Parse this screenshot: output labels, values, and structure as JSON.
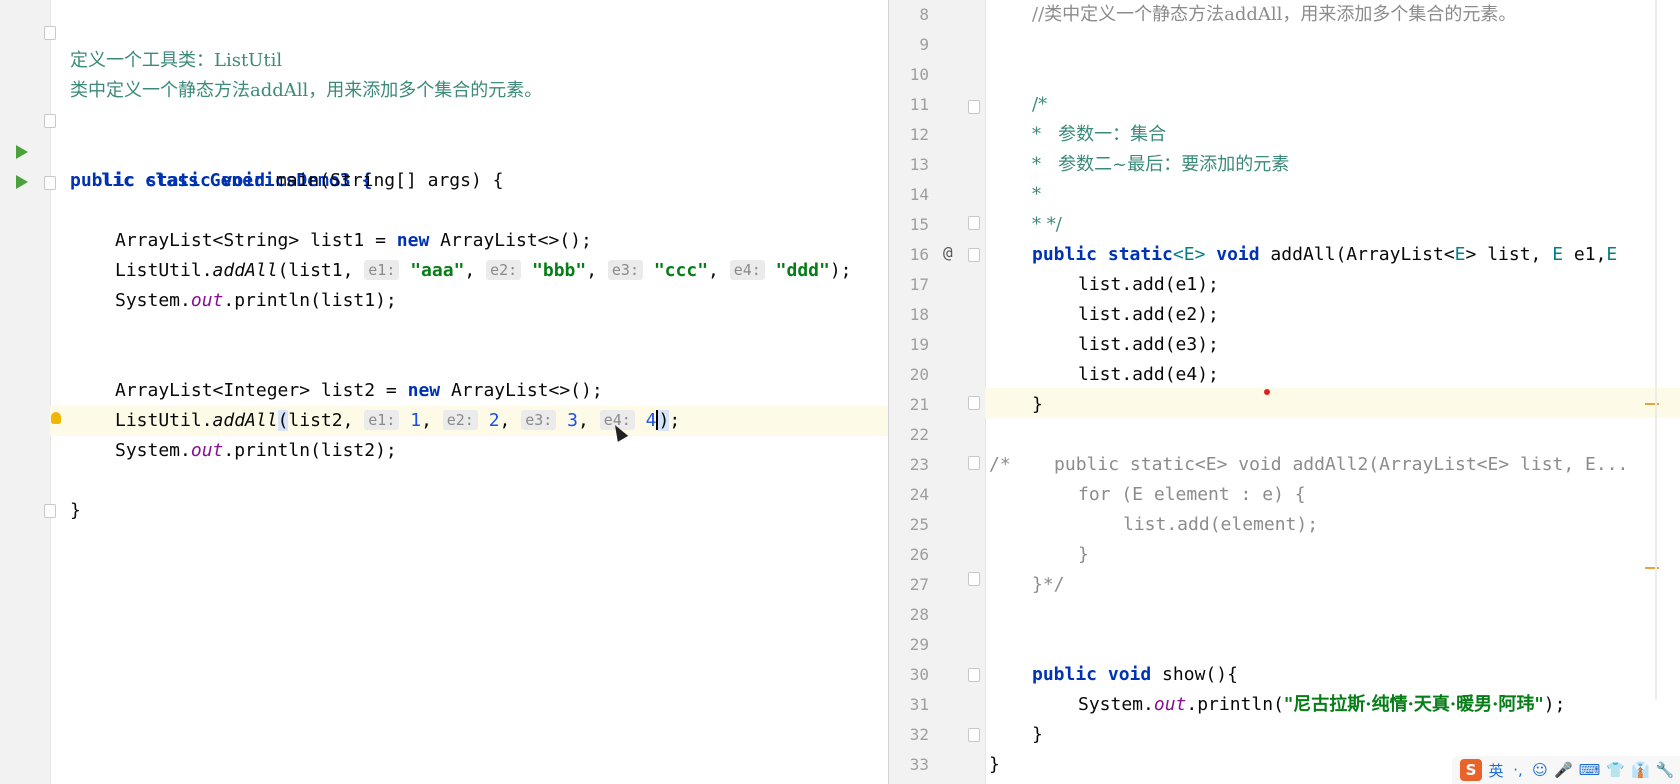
{
  "left_editor": {
    "doc_line1": "定义一个工具类：ListUtil",
    "doc_line2": "类中定义一个静态方法addAll，用来添加多个集合的元素。",
    "class_decl": "lic class GenericsDemo3 {",
    "main_decl": {
      "kw": "public static void",
      "rest": " main(String[] args) {"
    },
    "list1_decl": {
      "pre": "ArrayList<String> list1 = ",
      "kw": "new",
      "post": " ArrayList<>();"
    },
    "call1": {
      "obj": "ListUtil.",
      "method": "addAll",
      "open": "(list1, ",
      "h1": "e1:",
      "v1": "\"aaa\"",
      "sep1": ", ",
      "h2": "e2:",
      "v2": "\"bbb\"",
      "sep2": ", ",
      "h3": "e3:",
      "v3": "\"ccc\"",
      "sep3": ", ",
      "h4": "e4:",
      "v4": "\"ddd\"",
      "close": ");"
    },
    "print1": {
      "pre": "System.",
      "fld": "out",
      "post": ".println(list1);"
    },
    "list2_decl": {
      "pre": "ArrayList<Integer> list2 = ",
      "kw": "new",
      "post": " ArrayList<>();"
    },
    "call2": {
      "obj": "ListUtil.",
      "method": "addAll",
      "paren": "(",
      "open": "list2, ",
      "h1": "e1:",
      "v1": "1",
      "sep1": ", ",
      "h2": "e2:",
      "v2": "2",
      "sep2": ", ",
      "h3": "e3:",
      "v3": "3",
      "sep3": ", ",
      "h4": "e4:",
      "v4": "4",
      "close_paren": ")",
      "semi": ";"
    },
    "print2": {
      "pre": "System.",
      "fld": "out",
      "post": ".println(list2);"
    },
    "closing": "}"
  },
  "right_editor": {
    "line_numbers": [
      "8",
      "9",
      "10",
      "11",
      "12",
      "13",
      "14",
      "15",
      "16",
      "17",
      "18",
      "19",
      "20",
      "21",
      "22",
      "23",
      "24",
      "25",
      "26",
      "27",
      "28",
      "29",
      "30",
      "31",
      "32",
      "33"
    ],
    "l8": "//类中定义一个静态方法addAll，用来添加多个集合的元素。",
    "l11": "/*",
    "l12": "*   参数一：集合",
    "l13": "*   参数二~最后：要添加的元素",
    "l14": "*",
    "l15": "* */",
    "l16": {
      "kw": "public static",
      "tp1": "<E>",
      "kw2": " void",
      "rest": " addAll(ArrayList<",
      "tp2": "E",
      "rest2": "> list, ",
      "tp3": "E",
      "rest3": " e1,",
      "tp4": "E"
    },
    "l17": "list.add(e1);",
    "l18": "list.add(e2);",
    "l19": "list.add(e3);",
    "l20": "list.add(e4);",
    "l21": "}",
    "l23_prefix": "/*",
    "l23": "    public static<E> void addAll2(ArrayList<E> list, E...",
    "l24": "for (E element : e) {",
    "l25": "list.add(element);",
    "l26": "}",
    "l27": "}*/",
    "l30": {
      "kw": "public void",
      "rest": " show(){"
    },
    "l31": {
      "pre": "System.",
      "fld": "out",
      "mid": ".println(",
      "str": "\"尼古拉斯·纯情·天真·暖男·阿玮\"",
      "post": ");"
    },
    "l32": "}",
    "l33": "}"
  },
  "gutter_marks": {
    "override_icon": "@"
  },
  "ime_toolbar": {
    "logo": "S",
    "lang": "英",
    "items": [
      "·,",
      "☺",
      "🎤",
      "⌨",
      "👕",
      "👔",
      "🔧"
    ]
  }
}
